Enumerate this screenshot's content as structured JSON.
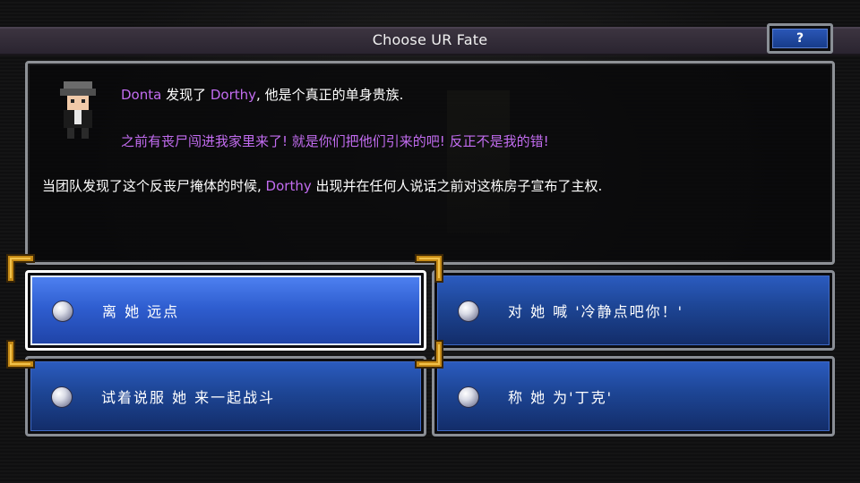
{
  "window": {
    "title": "Choose UR Fate",
    "help_label": "?"
  },
  "dialog": {
    "line1": {
      "speaker": "Donta",
      "text_a": " 发现了 ",
      "name2": "Dorthy",
      "text_b": ", 他是个真正的单身贵族."
    },
    "line2": "之前有丧尸闯进我家里来了! 就是你们把他们引来的吧! 反正不是我的错!",
    "line3": {
      "text_a": "当团队发现了这个反丧尸掩体的时候, ",
      "name": "Dorthy",
      "text_b": " 出现并在任何人说话之前对这栋房子宣布了主权."
    }
  },
  "choices": [
    {
      "label": "离 她 远点",
      "selected": true
    },
    {
      "label": "对 她 喊 '冷静点吧你！'",
      "selected": false
    },
    {
      "label": "试着说服 她 来一起战斗",
      "selected": false
    },
    {
      "label": "称 她 为'丁克'",
      "selected": false
    }
  ],
  "colors": {
    "name_highlight": "#c26cf0",
    "button_blue": "#1d4594",
    "selection_gold": "#e0a020"
  },
  "icons": {
    "portrait": "survivor-portrait-icon",
    "radio": "radio-orb-icon",
    "corner": "selection-corner-icon"
  }
}
